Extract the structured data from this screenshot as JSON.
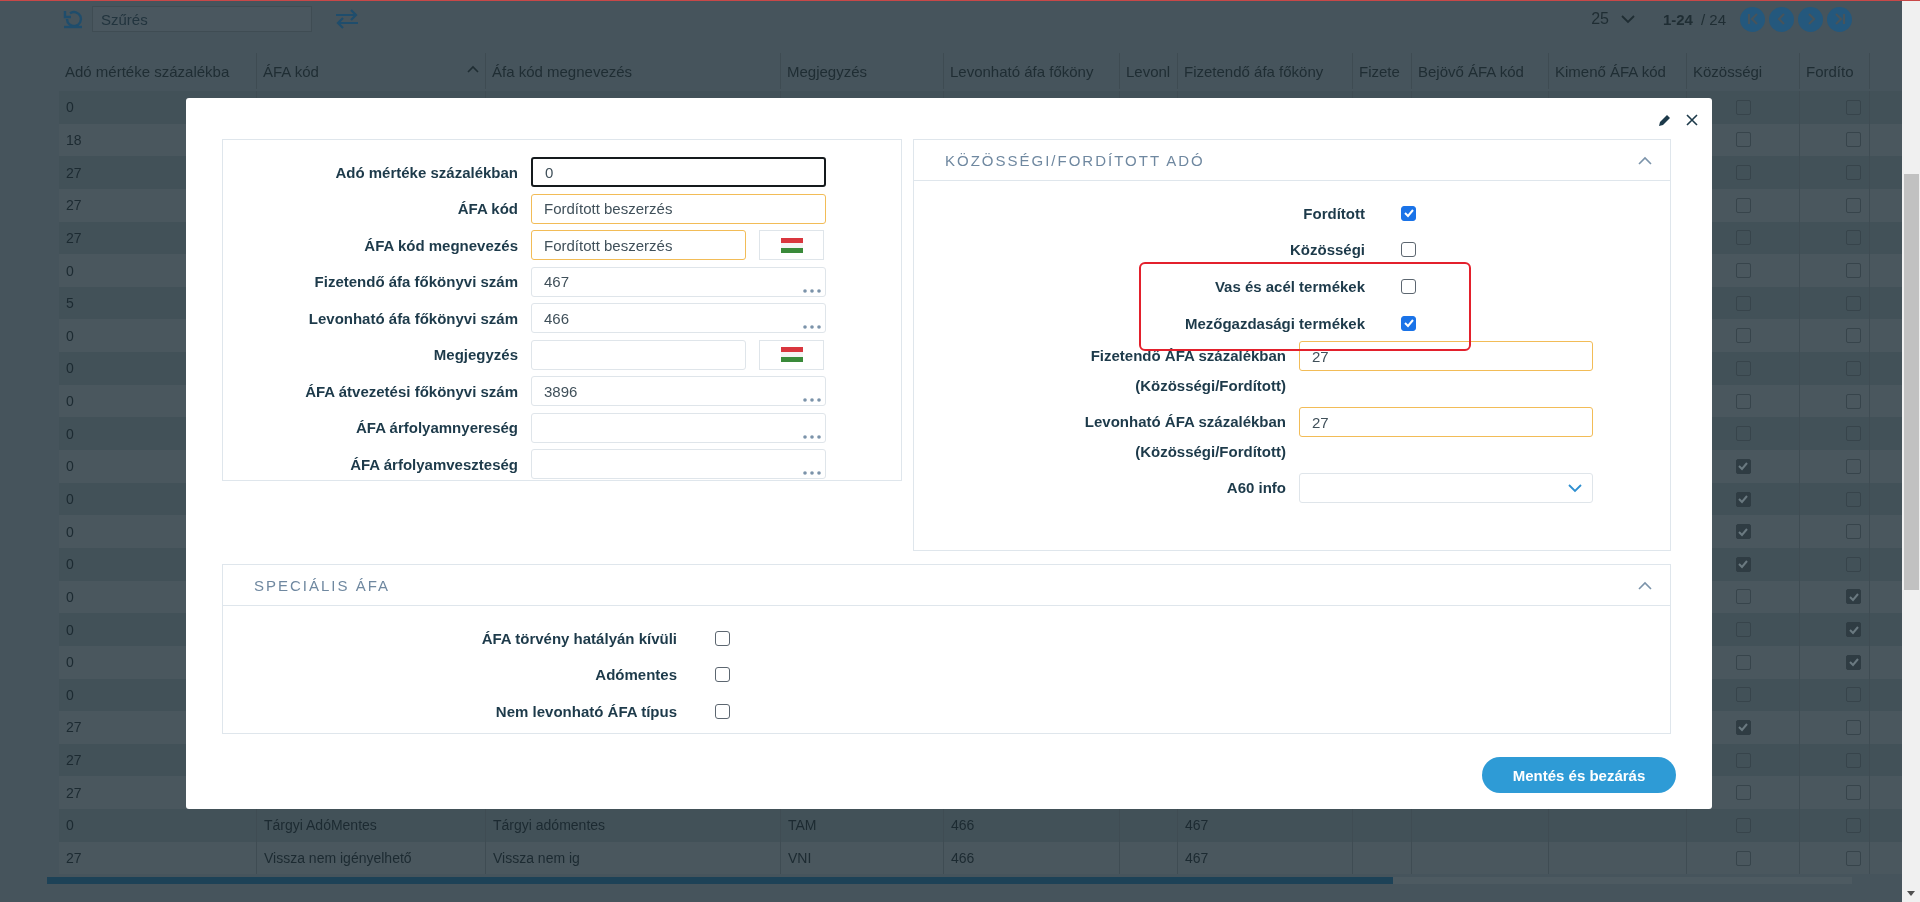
{
  "toolbar": {
    "filter_placeholder": "Szűrés",
    "page_size": "25",
    "range": "1-24",
    "total": "/ 24"
  },
  "table": {
    "columns": [
      {
        "label": "Adó mértéke százalékba",
        "sorted": false
      },
      {
        "label": "ÁFA kód",
        "sorted": true
      },
      {
        "label": "Áfa kód megnevezés",
        "sorted": false
      },
      {
        "label": "Megjegyzés",
        "sorted": false
      },
      {
        "label": "Levonható áfa főköny",
        "sorted": false
      },
      {
        "label": "Levonl",
        "sorted": false
      },
      {
        "label": "Fizetendő áfa főköny",
        "sorted": false
      },
      {
        "label": "Fizete",
        "sorted": false
      },
      {
        "label": "Bejövő ÁFA kód",
        "sorted": false
      },
      {
        "label": "Kimenő ÁFA kód",
        "sorted": false
      },
      {
        "label": "Közösségi",
        "sorted": false
      },
      {
        "label": "Fordíto",
        "sorted": false
      }
    ],
    "rows": [
      {
        "rate": "0",
        "community": false,
        "reverse": false
      },
      {
        "rate": "18",
        "community": false,
        "reverse": false
      },
      {
        "rate": "27",
        "community": false,
        "reverse": false
      },
      {
        "rate": "27",
        "community": false,
        "reverse": false
      },
      {
        "rate": "27",
        "community": false,
        "reverse": false
      },
      {
        "rate": "0",
        "community": false,
        "reverse": false
      },
      {
        "rate": "5",
        "community": false,
        "reverse": false
      },
      {
        "rate": "0",
        "community": false,
        "reverse": false
      },
      {
        "rate": "0",
        "community": false,
        "reverse": false
      },
      {
        "rate": "0",
        "community": false,
        "reverse": false
      },
      {
        "rate": "0",
        "community": false,
        "reverse": false
      },
      {
        "rate": "0",
        "community": true,
        "reverse": false
      },
      {
        "rate": "0",
        "community": true,
        "reverse": false
      },
      {
        "rate": "0",
        "community": true,
        "reverse": false
      },
      {
        "rate": "0",
        "community": true,
        "reverse": false
      },
      {
        "rate": "0",
        "community": false,
        "reverse": true
      },
      {
        "rate": "0",
        "community": false,
        "reverse": true
      },
      {
        "rate": "0",
        "community": false,
        "reverse": true
      },
      {
        "rate": "0",
        "community": false,
        "reverse": false
      },
      {
        "rate": "27",
        "community": true,
        "reverse": false
      },
      {
        "rate": "27",
        "community": false,
        "reverse": false
      },
      {
        "rate": "27",
        "community": false,
        "reverse": false
      },
      {
        "rate": "0",
        "code": "Tárgyi AdóMentes",
        "name": "Tárgyi adómentes",
        "note": "TAM",
        "deductible": "466",
        "payable": "467",
        "community": false,
        "reverse": false
      },
      {
        "rate": "27",
        "code": "Vissza nem igényelhető",
        "name": "Vissza nem ig",
        "note": "VNI",
        "deductible": "466",
        "payable": "467",
        "community": false,
        "reverse": false
      }
    ]
  },
  "dialog": {
    "general": {
      "fields": [
        {
          "label": "Adó mértéke százalékban",
          "value": "0",
          "kind": "text",
          "required": false,
          "focused": true
        },
        {
          "label": "ÁFA kód",
          "value": "Fordított beszerzés",
          "kind": "text",
          "required": true,
          "focused": false
        },
        {
          "label": "ÁFA kód megnevezés",
          "value": "Fordított beszerzés",
          "kind": "translated",
          "required": true,
          "focused": false
        },
        {
          "label": "Fizetendő áfa főkönyvi szám",
          "value": "467",
          "kind": "lookup",
          "required": false,
          "focused": false
        },
        {
          "label": "Levonható áfa főkönyvi szám",
          "value": "466",
          "kind": "lookup",
          "required": false,
          "focused": false
        },
        {
          "label": "Megjegyzés",
          "kind": "translated",
          "required": false,
          "focused": false
        },
        {
          "label": "ÁFA átvezetési főkönyvi szám",
          "value": "3896",
          "kind": "lookup",
          "required": false,
          "focused": false
        },
        {
          "label": "ÁFA árfolyamnyereség",
          "kind": "lookup",
          "required": false,
          "focused": false
        },
        {
          "label": "ÁFA árfolyamveszteség",
          "kind": "lookup",
          "required": false,
          "focused": false
        }
      ]
    },
    "reverse_charge": {
      "title": "KÖZÖSSÉGI/FORDÍTOTT ADÓ",
      "expanded": true,
      "checkboxes": [
        {
          "label": "Fordított",
          "checked": true
        },
        {
          "label": "Közösségi",
          "checked": false
        },
        {
          "label": "Vas és acél termékek",
          "checked": false
        },
        {
          "label": "Mezőgazdasági termékek",
          "checked": true
        }
      ],
      "fields": [
        {
          "label": "Fizetendő ÁFA százalékban",
          "note": "(Közösségi/Fordított)",
          "value": "27",
          "kind": "text",
          "required": true
        },
        {
          "label": "Levonható ÁFA százalékban",
          "note": "(Közösségi/Fordított)",
          "value": "27",
          "kind": "text",
          "required": true
        },
        {
          "label": "A60 info",
          "kind": "select",
          "required": false
        }
      ]
    },
    "special": {
      "title": "SPECIÁLIS ÁFA",
      "expanded": true,
      "checkboxes": [
        {
          "label": "ÁFA törvény hatályán kívüli",
          "checked": false
        },
        {
          "label": "Adómentes",
          "checked": false
        },
        {
          "label": "Nem levonható ÁFA típus",
          "checked": false
        }
      ]
    },
    "save_button": "Mentés és bezárás"
  }
}
